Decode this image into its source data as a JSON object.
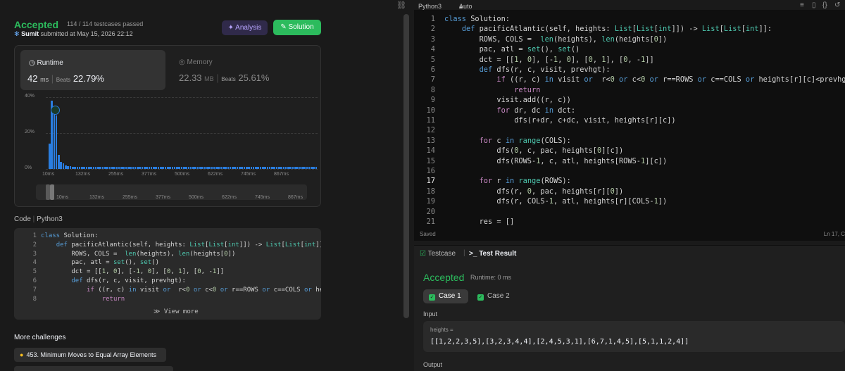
{
  "submission": {
    "status": "Accepted",
    "testcases": "114 / 114 testcases passed",
    "user": "Sumit",
    "submitted_text": "submitted at May 15, 2026 22:12",
    "analysis_label": "Analysis",
    "solution_label": "Solution"
  },
  "runtime": {
    "title": "Runtime",
    "value": "42",
    "unit": "ms",
    "beats_label": "Beats",
    "beats": "22.79%"
  },
  "memory": {
    "title": "Memory",
    "value": "22.33",
    "unit": "MB",
    "beats_label": "Beats",
    "beats": "25.61%"
  },
  "chart_data": {
    "type": "bar",
    "y_ticks": [
      "40%",
      "20%",
      "0%"
    ],
    "ylim": [
      0,
      40
    ],
    "x_ticks": [
      "10ms",
      "132ms",
      "255ms",
      "377ms",
      "500ms",
      "622ms",
      "745ms",
      "867ms"
    ],
    "values": [
      14,
      38,
      34,
      30,
      8,
      4,
      3,
      2,
      1.5,
      1.5,
      1.2,
      1.2,
      1.2,
      1.2,
      1.2,
      1.2,
      1.2,
      1.2,
      1.2,
      1.2,
      1.2,
      1.2,
      1.2,
      1.2,
      1.2,
      1.2,
      1.2,
      1.2,
      1.2,
      1.2,
      1.2,
      1.2,
      1.2,
      1.2,
      1.2,
      1.2,
      1.2,
      1.2,
      1.2,
      1.2,
      1.2,
      1.2,
      1.2,
      1.2,
      1.2,
      1.2,
      1.2,
      1.2,
      1.2,
      1.2,
      1.2,
      1.2,
      1.2,
      1.2,
      1.2,
      1.2,
      1.2,
      1.2,
      1.2,
      1.2,
      1.2,
      1.2,
      1.2,
      1.2,
      1.2,
      1.2,
      1.2,
      1.2,
      1.2,
      1.2,
      1.2,
      1.2,
      1.2,
      1.2,
      1.2,
      1.2,
      1.2,
      1.2,
      1.2,
      1.2,
      1.2,
      1.2,
      1.2,
      1.2,
      1.2,
      1.2,
      1.2,
      1.2,
      1.2,
      1.2,
      1.2,
      1.2,
      1.2,
      1.2,
      1.2,
      1.2,
      1.2,
      1.2,
      1.2,
      1.2,
      1.2,
      1.2,
      1.2,
      1.2,
      1.2,
      1.2,
      1.2,
      1.2,
      1.2,
      1.2,
      1.2,
      1.2,
      1.2,
      1.2,
      1.2,
      1.2
    ],
    "highlight_index": 2
  },
  "code_panel": {
    "label": "Code",
    "language": "Python3",
    "lines": [
      "class Solution:",
      "    def pacificAtlantic(self, heights: List[List[int]]) -> List[List[int]]:",
      "        ROWS, COLS =  len(heights), len(heights[0])",
      "        pac, atl = set(), set()",
      "        dct = [[1, 0], [-1, 0], [0, 1], [0, -1]]",
      "        def dfs(r, c, visit, prevhgt):",
      "            if ((r, c) in visit or  r<0 or c<0 or r==ROWS or c==COLS or heig",
      "                return"
    ],
    "view_more": "View more"
  },
  "more_challenges": {
    "title": "More challenges",
    "items": [
      "453. Minimum Moves to Equal Array Elements"
    ]
  },
  "editor": {
    "language": "Python3",
    "mode": "Auto",
    "status": "Saved",
    "cursor": "Ln 17, C",
    "lines": [
      "class Solution:",
      "    def pacificAtlantic(self, heights: List[List[int]]) -> List[List[int]]:",
      "        ROWS, COLS =  len(heights), len(heights[0])",
      "        pac, atl = set(), set()",
      "        dct = [[1, 0], [-1, 0], [0, 1], [0, -1]]",
      "        def dfs(r, c, visit, prevhgt):",
      "            if ((r, c) in visit or  r<0 or c<0 or r==ROWS or c==COLS or heights[r][c]<prevhgt):",
      "                return",
      "            visit.add((r, c))",
      "            for dr, dc in dct:",
      "                dfs(r+dr, c+dc, visit, heights[r][c])",
      "",
      "        for c in range(COLS):",
      "            dfs(0, c, pac, heights[0][c])",
      "            dfs(ROWS-1, c, atl, heights[ROWS-1][c])",
      "",
      "        for r in range(ROWS):",
      "            dfs(r, 0, pac, heights[r][0])",
      "            dfs(r, COLS-1, atl, heights[r][COLS-1])",
      "",
      "        res = []"
    ]
  },
  "result": {
    "tab_testcase": "Testcase",
    "tab_result": "Test Result",
    "status": "Accepted",
    "runtime": "Runtime: 0 ms",
    "cases": [
      "Case 1",
      "Case 2"
    ],
    "input_label": "Input",
    "input_name": "heights =",
    "input_value": "[[1,2,2,3,5],[3,2,3,4,4],[2,4,5,3,1],[6,7,1,4,5],[5,1,1,2,4]]",
    "output_label": "Output"
  }
}
